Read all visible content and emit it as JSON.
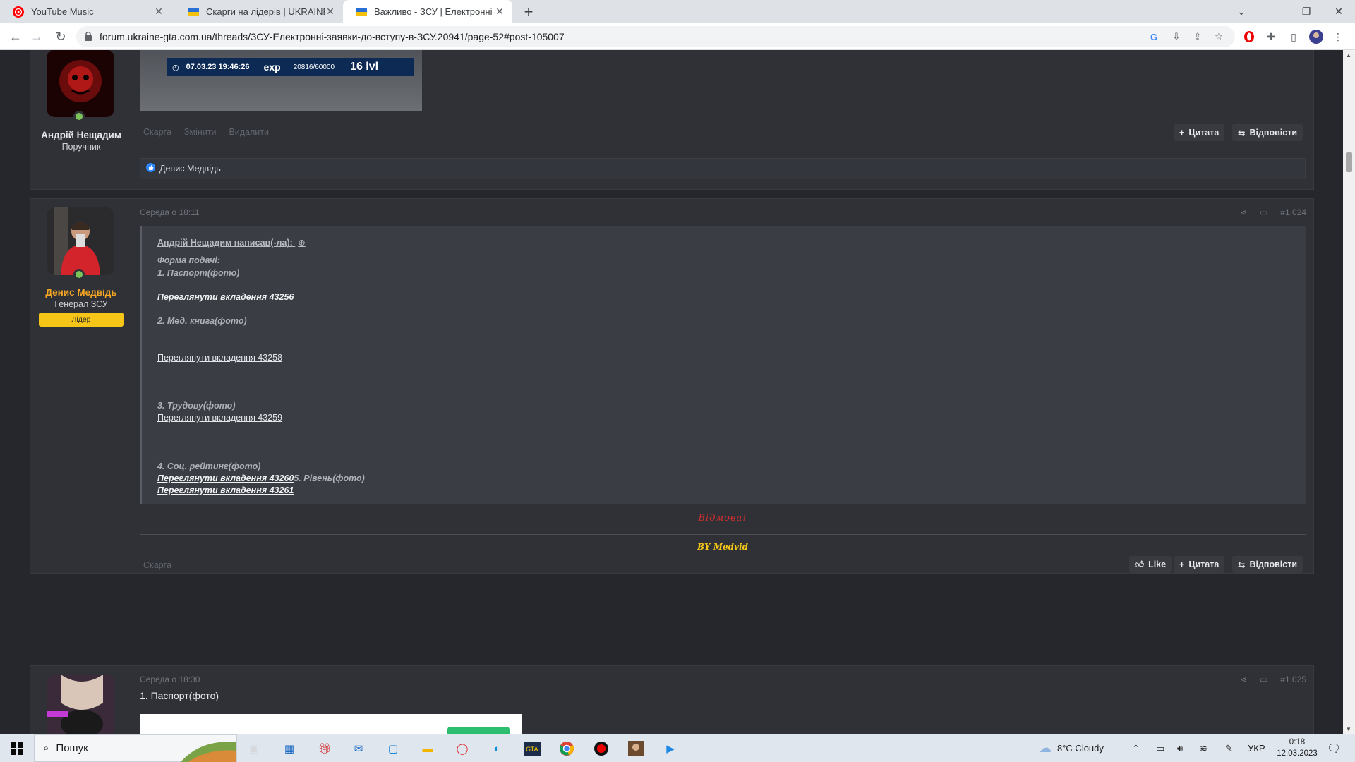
{
  "browser": {
    "tabs": [
      {
        "title": "YouTube Music",
        "icon": "youtube-music-icon"
      },
      {
        "title": "Скарги на лідерів | UKRAINE GTA",
        "icon": "ukraine-gta-icon"
      },
      {
        "title": "Важливо - ЗСУ | Електронні заяв",
        "icon": "ukraine-gta-icon"
      }
    ],
    "url": "forum.ukraine-gta.com.ua/threads/ЗСУ-Електронні-заявки-до-вступу-в-ЗСУ.20941/page-52#post-105007"
  },
  "post1": {
    "image_caption": {
      "datetime": "07.03.23 19:46:26",
      "exp_label": "exp",
      "exp_value": "20816/60000",
      "level": "16 lvl"
    },
    "author": {
      "name": "Андрій Нещадим",
      "rank": "Поручник"
    },
    "actions_left": [
      "Скарга",
      "Змінити",
      "Видалити"
    ],
    "quote_label": "Цитата",
    "reply_label": "Відповісти",
    "reaction_user": "Денис Медвідь"
  },
  "post2": {
    "time": "Середа о 18:11",
    "number": "#1,024",
    "author": {
      "name": "Денис Медвідь",
      "rank": "Генерал ЗСУ",
      "badge": "Лідер"
    },
    "quote_author": "Андрій Нещадим написав(-ла):",
    "quote_lines": {
      "form": "Форма подачі:",
      "l1": "1. Паспорт(фото)",
      "a1": "Переглянути вкладення 43256",
      "l2": "2. Мед. книга(фото)",
      "a2": "Переглянути вкладення 43258",
      "l3": "3. Трудову(фото)",
      "a3": "Переглянути вкладення 43259",
      "l4": "4. Соц. рейтинг(фото)",
      "a4": "Переглянути вкладення 43260",
      "l5": "5. Рівень(фото)",
      "a5": "Переглянути вкладення 43261"
    },
    "verdict": "Відмова!",
    "signature": "BY Medvid",
    "report": "Скарга",
    "like_label": "Like",
    "quote_label": "Цитата",
    "reply_label": "Відповісти",
    "colors": {
      "verdict": "#d32f2f",
      "signature": "#f5c518",
      "author_name": "#f5a623"
    }
  },
  "post3": {
    "time": "Середа о 18:30",
    "number": "#1,025",
    "first_line": "1. Паспорт(фото)"
  },
  "taskbar": {
    "search_placeholder": "Пошук",
    "weather": "8°C  Cloudy",
    "lang": "УКР",
    "time": "0:18",
    "date": "12.03.2023"
  }
}
